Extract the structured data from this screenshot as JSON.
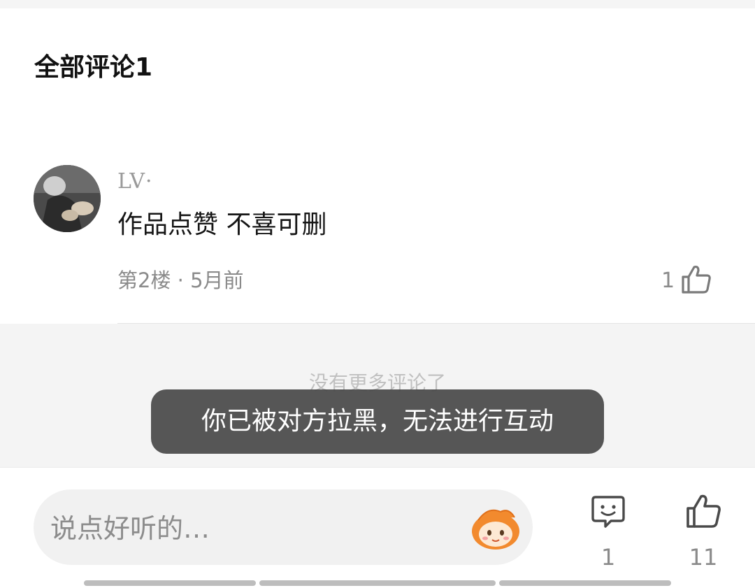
{
  "header": {
    "title": "全部评论1"
  },
  "comment": {
    "username": "LV·",
    "text": "作品点赞 不喜可删",
    "meta": "第2楼 · 5月前",
    "like_count": "1"
  },
  "footer_hint": "没有更多评论了",
  "toast": "你已被对方拉黑，无法进行互动",
  "bottom": {
    "placeholder": "说点好听的…",
    "comment_count": "1",
    "like_count": "11"
  },
  "icons": {
    "comment_like": "thumbs-up-icon",
    "emoji": "emoji-sticker-icon",
    "comment": "smiley-comment-icon",
    "bottom_like": "thumbs-up-icon"
  }
}
